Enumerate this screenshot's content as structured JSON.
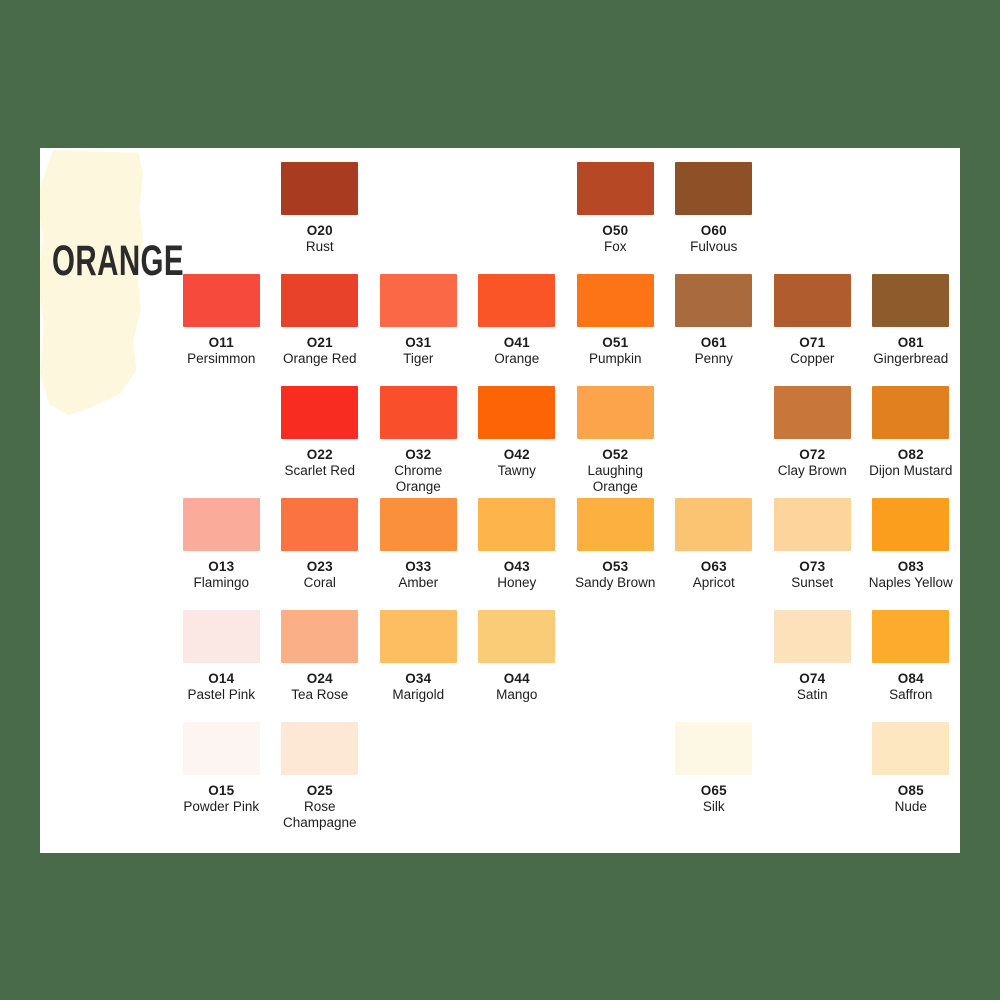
{
  "page": {
    "background_color": "#4a6b4a",
    "card_background": "#ffffff",
    "title": "ORANGE",
    "title_color": "#2b2b2b",
    "paint_stroke_color": "#fdf8dd"
  },
  "chart_data": {
    "type": "table",
    "title": "ORANGE",
    "columns": 8,
    "rows": 6,
    "swatches": [
      {
        "row": 1,
        "col": 2,
        "code": "O20",
        "name": "Rust",
        "hex": "#a93b20"
      },
      {
        "row": 1,
        "col": 5,
        "code": "O50",
        "name": "Fox",
        "hex": "#b74825"
      },
      {
        "row": 1,
        "col": 6,
        "code": "O60",
        "name": "Fulvous",
        "hex": "#8e5026"
      },
      {
        "row": 2,
        "col": 1,
        "code": "O11",
        "name": "Persimmon",
        "hex": "#f64a3c"
      },
      {
        "row": 2,
        "col": 2,
        "code": "O21",
        "name": "Orange Red",
        "hex": "#e8432a"
      },
      {
        "row": 2,
        "col": 3,
        "code": "O31",
        "name": "Tiger",
        "hex": "#fb6845"
      },
      {
        "row": 2,
        "col": 4,
        "code": "O41",
        "name": "Orange",
        "hex": "#fa5526"
      },
      {
        "row": 2,
        "col": 5,
        "code": "O51",
        "name": "Pumpkin",
        "hex": "#fc7415"
      },
      {
        "row": 2,
        "col": 6,
        "code": "O61",
        "name": "Penny",
        "hex": "#a96a3e"
      },
      {
        "row": 2,
        "col": 7,
        "code": "O71",
        "name": "Copper",
        "hex": "#b05c2e"
      },
      {
        "row": 2,
        "col": 8,
        "code": "O81",
        "name": "Gingerbread",
        "hex": "#8e5b2c"
      },
      {
        "row": 3,
        "col": 2,
        "code": "O22",
        "name": "Scarlet Red",
        "hex": "#f92c21"
      },
      {
        "row": 3,
        "col": 3,
        "code": "O32",
        "name": "Chrome Orange",
        "hex": "#f9502b"
      },
      {
        "row": 3,
        "col": 4,
        "code": "O42",
        "name": "Tawny",
        "hex": "#fc6406"
      },
      {
        "row": 3,
        "col": 5,
        "code": "O52",
        "name": "Laughing Orange",
        "hex": "#fba44c"
      },
      {
        "row": 3,
        "col": 7,
        "code": "O72",
        "name": "Clay Brown",
        "hex": "#c9763a"
      },
      {
        "row": 3,
        "col": 8,
        "code": "O82",
        "name": "Dijon Mustard",
        "hex": "#e0801f"
      },
      {
        "row": 4,
        "col": 1,
        "code": "O13",
        "name": "Flamingo",
        "hex": "#fbab99"
      },
      {
        "row": 4,
        "col": 2,
        "code": "O23",
        "name": "Coral",
        "hex": "#fa7340"
      },
      {
        "row": 4,
        "col": 3,
        "code": "O33",
        "name": "Amber",
        "hex": "#fa8f3c"
      },
      {
        "row": 4,
        "col": 4,
        "code": "O43",
        "name": "Honey",
        "hex": "#fcb44b"
      },
      {
        "row": 4,
        "col": 5,
        "code": "O53",
        "name": "Sandy Brown",
        "hex": "#fcb03f"
      },
      {
        "row": 4,
        "col": 6,
        "code": "O63",
        "name": "Apricot",
        "hex": "#fbc473"
      },
      {
        "row": 4,
        "col": 7,
        "code": "O73",
        "name": "Sunset",
        "hex": "#fcd49c"
      },
      {
        "row": 4,
        "col": 8,
        "code": "O83",
        "name": "Naples Yellow",
        "hex": "#fb9e1e"
      },
      {
        "row": 5,
        "col": 1,
        "code": "O14",
        "name": "Pastel Pink",
        "hex": "#fbe8e4"
      },
      {
        "row": 5,
        "col": 2,
        "code": "O24",
        "name": "Tea Rose",
        "hex": "#fbaf87"
      },
      {
        "row": 5,
        "col": 3,
        "code": "O34",
        "name": "Marigold",
        "hex": "#fcbe61"
      },
      {
        "row": 5,
        "col": 4,
        "code": "O44",
        "name": "Mango",
        "hex": "#fbcc77"
      },
      {
        "row": 5,
        "col": 7,
        "code": "O74",
        "name": "Satin",
        "hex": "#fde1bb"
      },
      {
        "row": 5,
        "col": 8,
        "code": "O84",
        "name": "Saffron",
        "hex": "#fcab2c"
      },
      {
        "row": 6,
        "col": 1,
        "code": "O15",
        "name": "Powder Pink",
        "hex": "#fdf5f1"
      },
      {
        "row": 6,
        "col": 2,
        "code": "O25",
        "name": "Rose Champagne",
        "hex": "#fde7d5"
      },
      {
        "row": 6,
        "col": 6,
        "code": "O65",
        "name": "Silk",
        "hex": "#fcf8e3"
      },
      {
        "row": 6,
        "col": 8,
        "code": "O85",
        "name": "Nude",
        "hex": "#fce7c0"
      }
    ]
  }
}
